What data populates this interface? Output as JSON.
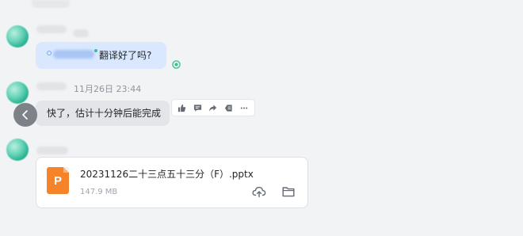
{
  "messages": [
    {
      "text": "翻译好了吗?"
    },
    {
      "timestamp": "11月26日 23:44",
      "text": "快了，估计十分钟后能完成",
      "actions": [
        "thumbs-up-icon",
        "comment-icon",
        "share-icon",
        "quote-reply-icon",
        "more-icon"
      ]
    },
    {
      "file": {
        "name": "20231126二十三点五十三分（F）.pptx",
        "size": "147.9 MB",
        "type_letter": "P",
        "type_color": "#f5832a"
      }
    }
  ],
  "colors": {
    "background": "#f2f3f5",
    "own_bubble": "#d9e8ff",
    "other_bubble": "#e3e5e8",
    "accent_green": "#2ec28f"
  }
}
